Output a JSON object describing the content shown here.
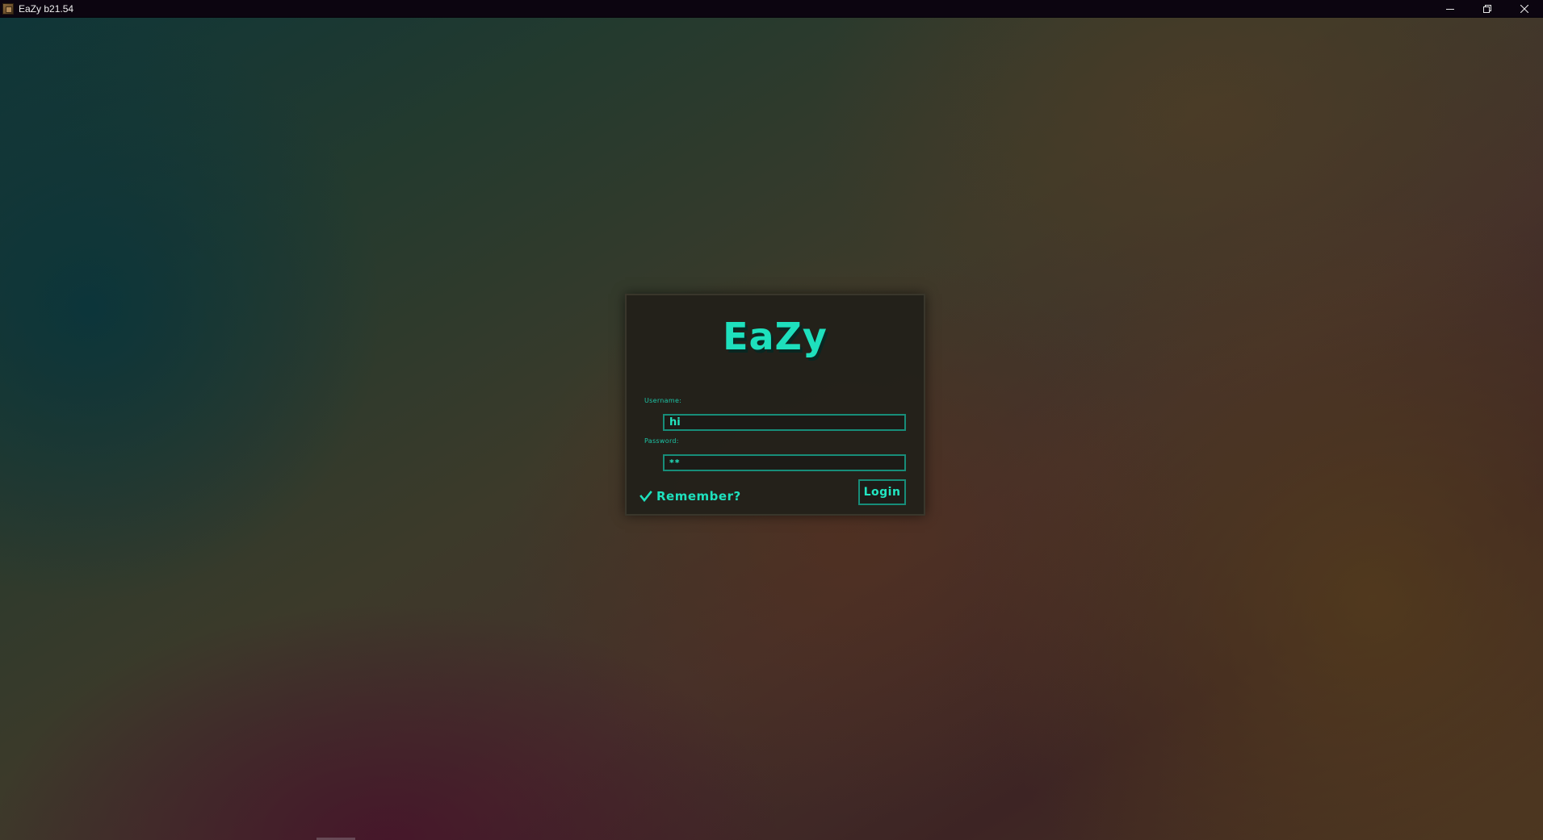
{
  "window": {
    "title": "EaZy b21.54",
    "app_icon": "minecraft-block-icon",
    "controls": {
      "minimize_icon": "minimize-icon",
      "restore_icon": "restore-icon",
      "close_icon": "close-icon"
    }
  },
  "login": {
    "logo": "EaZy",
    "username_label": "Username:",
    "username_value": "hi",
    "password_label": "Password:",
    "password_value": "**",
    "remember_label": "Remember?",
    "remember_checked": true,
    "remember_icon": "check-icon",
    "login_button": "Login"
  },
  "colors": {
    "accent": "#1ee0bd",
    "input_border": "#178d79",
    "panel_bg": "#22201a",
    "titlebar_bg": "#0c0510"
  }
}
